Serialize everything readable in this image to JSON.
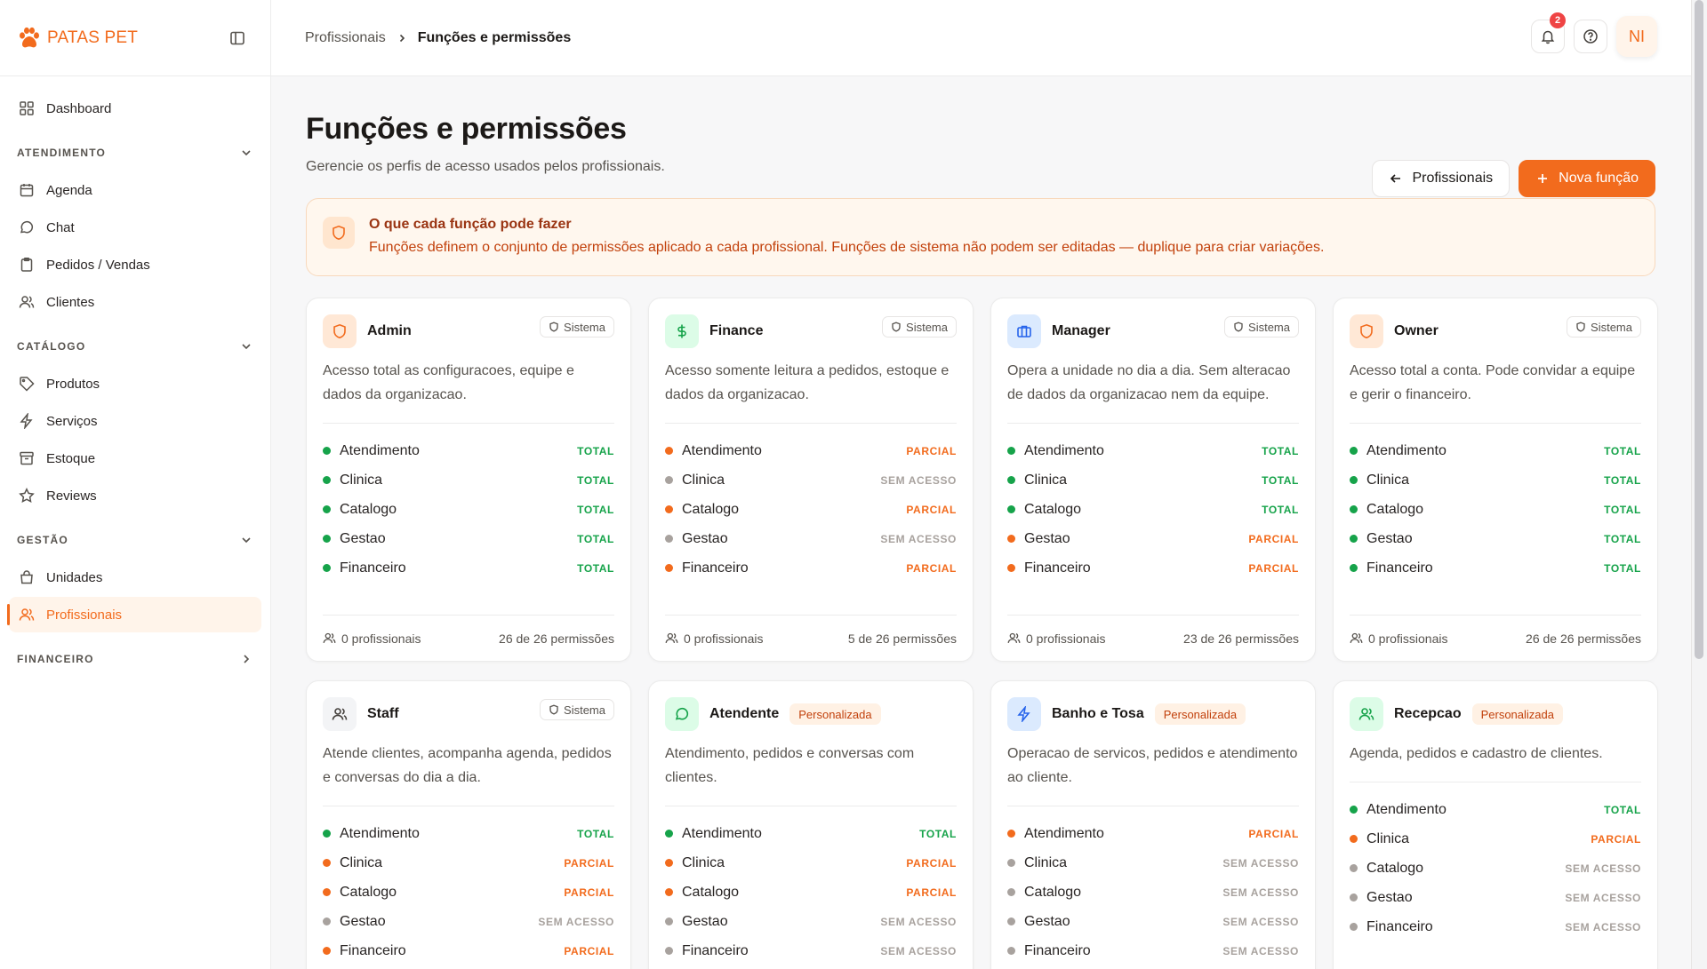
{
  "brand": {
    "name": "PATAS PET"
  },
  "colors": {
    "accent": "#f26b1d",
    "total": "#16a34a",
    "parcial": "#f26b1d",
    "none": "#a8a29e"
  },
  "sidebar": {
    "dashboard": "Dashboard",
    "sections": {
      "atendimento": "ATENDIMENTO",
      "catalogo": "CATÁLOGO",
      "gestao": "GESTÃO",
      "financeiro": "FINANCEIRO"
    },
    "items": {
      "agenda": "Agenda",
      "chat": "Chat",
      "pedidos": "Pedidos / Vendas",
      "clientes": "Clientes",
      "produtos": "Produtos",
      "servicos": "Serviços",
      "estoque": "Estoque",
      "reviews": "Reviews",
      "unidades": "Unidades",
      "profissionais": "Profissionais"
    }
  },
  "topbar": {
    "breadcrumb_parent": "Profissionais",
    "breadcrumb_current": "Funções e permissões",
    "notifications_count": "2",
    "avatar_initials": "NI"
  },
  "page": {
    "title": "Funções e permissões",
    "subtitle": "Gerencie os perfis de acesso usados pelos profissionais.",
    "back_button": "Profissionais",
    "new_button": "Nova função"
  },
  "info": {
    "title": "O que cada função pode fazer",
    "text": "Funções definem o conjunto de permissões aplicado a cada profissional. Funções de sistema não podem ser editadas — duplique para criar variações."
  },
  "labels": {
    "system": "Sistema",
    "custom": "Personalizada"
  },
  "roles": [
    {
      "name": "Admin",
      "type": "system",
      "icon": "shield-icon",
      "desc": "Acesso total as configuracoes, equipe e dados da organizacao.",
      "perms": [
        {
          "label": "Atendimento",
          "level": "TOTAL"
        },
        {
          "label": "Clinica",
          "level": "TOTAL"
        },
        {
          "label": "Catalogo",
          "level": "TOTAL"
        },
        {
          "label": "Gestao",
          "level": "TOTAL"
        },
        {
          "label": "Financeiro",
          "level": "TOTAL"
        }
      ],
      "professionals": "0 profissionais",
      "count": "26 de 26 permissões"
    },
    {
      "name": "Finance",
      "type": "system",
      "icon": "dollar-icon",
      "desc": "Acesso somente leitura a pedidos, estoque e dados da organizacao.",
      "perms": [
        {
          "label": "Atendimento",
          "level": "PARCIAL"
        },
        {
          "label": "Clinica",
          "level": "SEM ACESSO"
        },
        {
          "label": "Catalogo",
          "level": "PARCIAL"
        },
        {
          "label": "Gestao",
          "level": "SEM ACESSO"
        },
        {
          "label": "Financeiro",
          "level": "PARCIAL"
        }
      ],
      "professionals": "0 profissionais",
      "count": "5 de 26 permissões"
    },
    {
      "name": "Manager",
      "type": "system",
      "icon": "briefcase-icon",
      "desc": "Opera a unidade no dia a dia. Sem alteracao de dados da organizacao nem da equipe.",
      "perms": [
        {
          "label": "Atendimento",
          "level": "TOTAL"
        },
        {
          "label": "Clinica",
          "level": "TOTAL"
        },
        {
          "label": "Catalogo",
          "level": "TOTAL"
        },
        {
          "label": "Gestao",
          "level": "PARCIAL"
        },
        {
          "label": "Financeiro",
          "level": "PARCIAL"
        }
      ],
      "professionals": "0 profissionais",
      "count": "23 de 26 permissões"
    },
    {
      "name": "Owner",
      "type": "system",
      "icon": "shield-icon",
      "desc": "Acesso total a conta. Pode convidar a equipe e gerir o financeiro.",
      "perms": [
        {
          "label": "Atendimento",
          "level": "TOTAL"
        },
        {
          "label": "Clinica",
          "level": "TOTAL"
        },
        {
          "label": "Catalogo",
          "level": "TOTAL"
        },
        {
          "label": "Gestao",
          "level": "TOTAL"
        },
        {
          "label": "Financeiro",
          "level": "TOTAL"
        }
      ],
      "professionals": "0 profissionais",
      "count": "26 de 26 permissões"
    },
    {
      "name": "Staff",
      "type": "system",
      "icon": "users-icon",
      "desc": "Atende clientes, acompanha agenda, pedidos e conversas do dia a dia.",
      "perms": [
        {
          "label": "Atendimento",
          "level": "TOTAL"
        },
        {
          "label": "Clinica",
          "level": "PARCIAL"
        },
        {
          "label": "Catalogo",
          "level": "PARCIAL"
        },
        {
          "label": "Gestao",
          "level": "SEM ACESSO"
        },
        {
          "label": "Financeiro",
          "level": "PARCIAL"
        }
      ]
    },
    {
      "name": "Atendente",
      "type": "custom",
      "icon": "message-icon",
      "desc": "Atendimento, pedidos e conversas com clientes.",
      "perms": [
        {
          "label": "Atendimento",
          "level": "TOTAL"
        },
        {
          "label": "Clinica",
          "level": "PARCIAL"
        },
        {
          "label": "Catalogo",
          "level": "PARCIAL"
        },
        {
          "label": "Gestao",
          "level": "SEM ACESSO"
        },
        {
          "label": "Financeiro",
          "level": "SEM ACESSO"
        }
      ]
    },
    {
      "name": "Banho e Tosa",
      "type": "custom",
      "icon": "zap-icon",
      "desc": "Operacao de servicos, pedidos e atendimento ao cliente.",
      "perms": [
        {
          "label": "Atendimento",
          "level": "PARCIAL"
        },
        {
          "label": "Clinica",
          "level": "SEM ACESSO"
        },
        {
          "label": "Catalogo",
          "level": "SEM ACESSO"
        },
        {
          "label": "Gestao",
          "level": "SEM ACESSO"
        },
        {
          "label": "Financeiro",
          "level": "SEM ACESSO"
        }
      ]
    },
    {
      "name": "Recepcao",
      "type": "custom",
      "icon": "users-icon",
      "desc": "Agenda, pedidos e cadastro de clientes.",
      "perms": [
        {
          "label": "Atendimento",
          "level": "TOTAL"
        },
        {
          "label": "Clinica",
          "level": "PARCIAL"
        },
        {
          "label": "Catalogo",
          "level": "SEM ACESSO"
        },
        {
          "label": "Gestao",
          "level": "SEM ACESSO"
        },
        {
          "label": "Financeiro",
          "level": "SEM ACESSO"
        }
      ]
    }
  ]
}
